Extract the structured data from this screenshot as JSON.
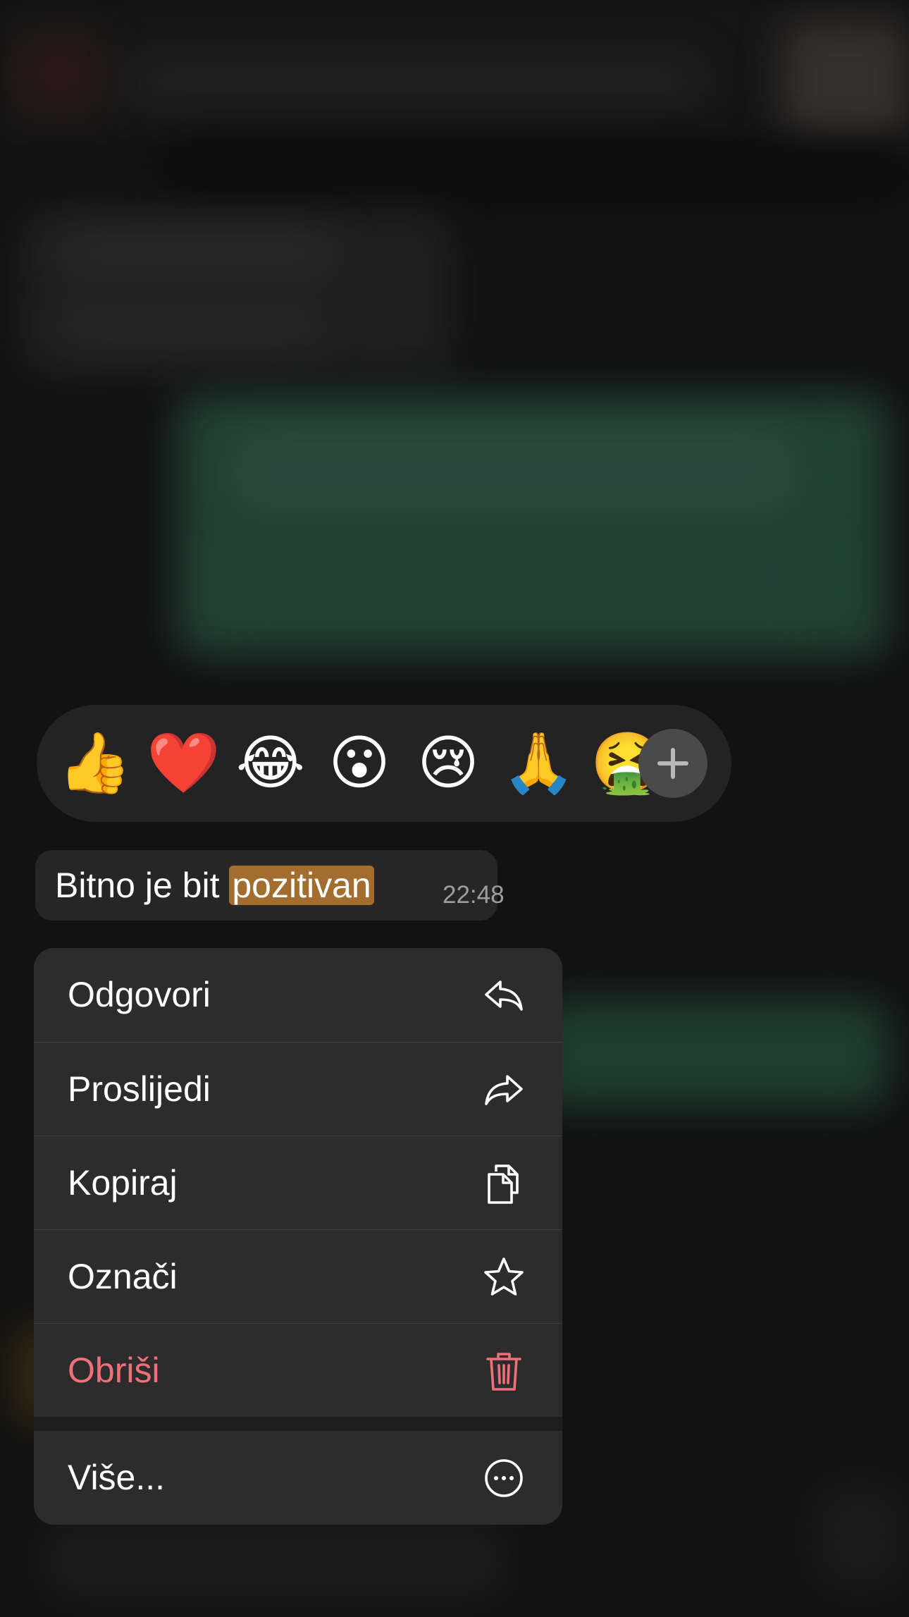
{
  "reactions": {
    "emojis": [
      "👍",
      "❤️",
      "😂",
      "😮",
      "😢",
      "🙏",
      "🤮"
    ],
    "add_icon": "plus-icon"
  },
  "message": {
    "text_before": "Bitno je bit ",
    "highlighted": "pozitivan",
    "time": "22:48"
  },
  "menu": {
    "items": [
      {
        "label": "Odgovori",
        "icon": "reply-icon"
      },
      {
        "label": "Proslijedi",
        "icon": "forward-icon"
      },
      {
        "label": "Kopiraj",
        "icon": "copy-icon"
      },
      {
        "label": "Označi",
        "icon": "star-icon"
      },
      {
        "label": "Obriši",
        "icon": "trash-icon"
      }
    ],
    "more": {
      "label": "Više...",
      "icon": "more-icon"
    }
  },
  "colors": {
    "menu_background": "#2c2c2c",
    "destructive": "#f0707a",
    "highlight": "#a26d2e",
    "bubble": "#262626"
  }
}
